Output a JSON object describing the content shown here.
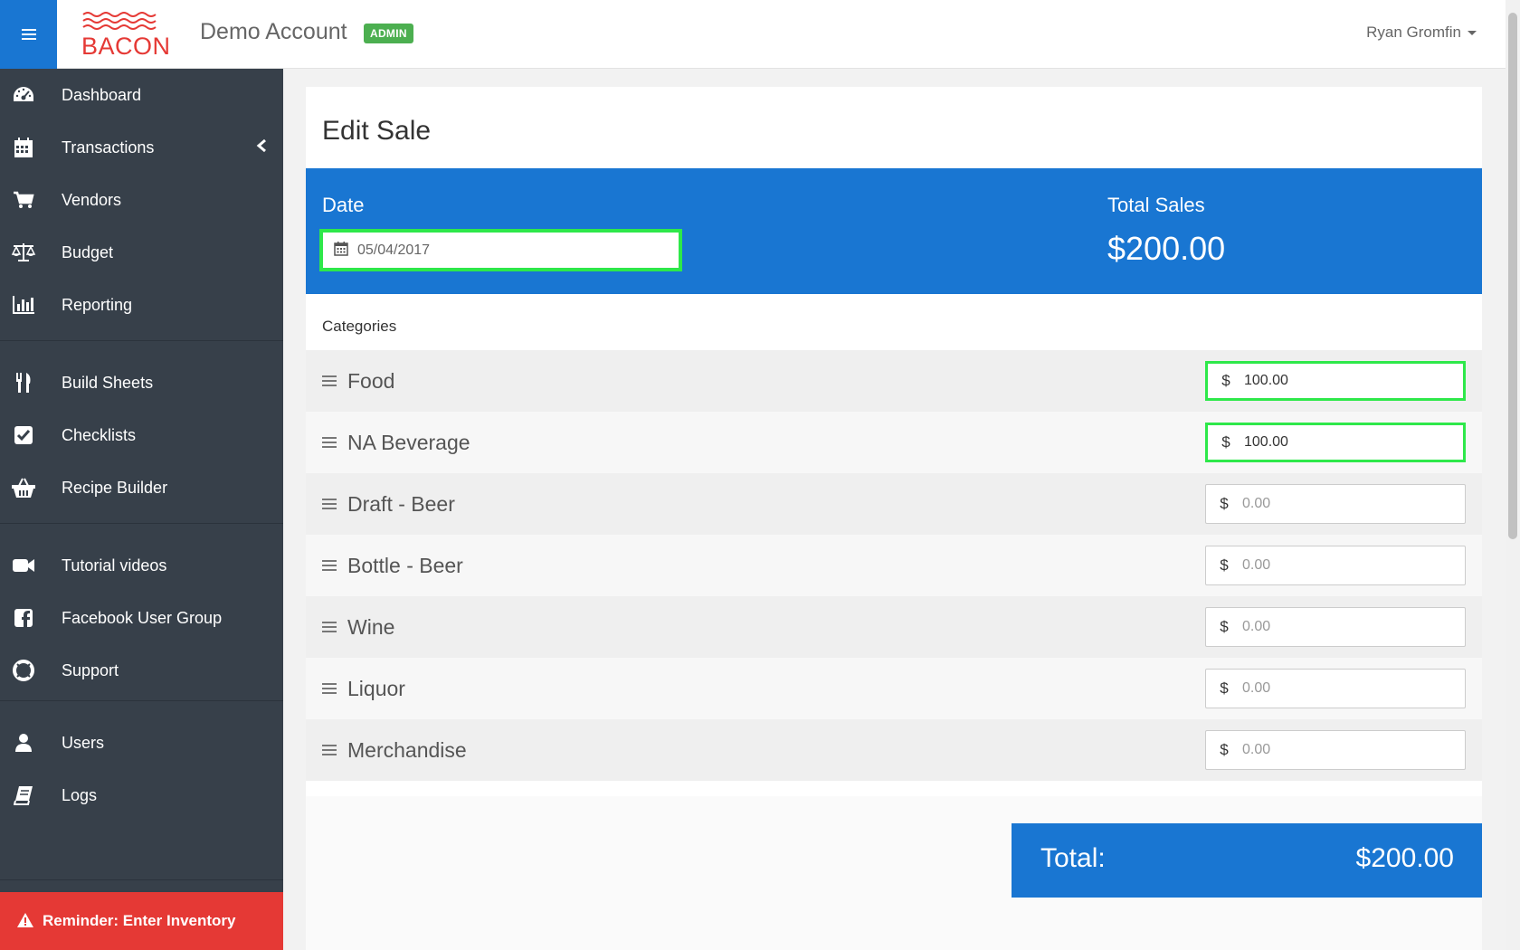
{
  "header": {
    "logo_text": "BACON",
    "account_name": "Demo Account",
    "badge": "ADMIN",
    "user_name": "Ryan Gromfin"
  },
  "sidebar": {
    "items": [
      {
        "label": "Dashboard",
        "icon": "dashboard-icon"
      },
      {
        "label": "Transactions",
        "icon": "calendar-icon"
      },
      {
        "label": "Vendors",
        "icon": "cart-icon"
      },
      {
        "label": "Budget",
        "icon": "balance-scale-icon"
      },
      {
        "label": "Reporting",
        "icon": "bar-chart-icon"
      },
      {
        "label": "Build Sheets",
        "icon": "utensils-icon"
      },
      {
        "label": "Checklists",
        "icon": "checkbox-icon"
      },
      {
        "label": "Recipe Builder",
        "icon": "basket-icon"
      },
      {
        "label": "Tutorial videos",
        "icon": "video-camera-icon"
      },
      {
        "label": "Facebook User Group",
        "icon": "facebook-icon"
      },
      {
        "label": "Support",
        "icon": "life-ring-icon"
      },
      {
        "label": "Users",
        "icon": "user-icon"
      },
      {
        "label": "Logs",
        "icon": "book-icon"
      }
    ],
    "reminder": "Reminder: Enter Inventory"
  },
  "page": {
    "title": "Edit Sale",
    "date_label": "Date",
    "date_value": "05/04/2017",
    "total_sales_label": "Total Sales",
    "total_sales_value": "$200.00",
    "categories_heading": "Categories",
    "currency_symbol": "$",
    "amount_placeholder": "0.00",
    "categories": [
      {
        "name": "Food",
        "value": "100.00"
      },
      {
        "name": "NA Beverage",
        "value": "100.00"
      },
      {
        "name": "Draft - Beer",
        "value": ""
      },
      {
        "name": "Bottle - Beer",
        "value": ""
      },
      {
        "name": "Wine",
        "value": ""
      },
      {
        "name": "Liquor",
        "value": ""
      },
      {
        "name": "Merchandise",
        "value": ""
      }
    ],
    "total_label": "Total:",
    "total_value": "$200.00"
  },
  "colors": {
    "primary": "#1976d2",
    "sidebar": "#37404a",
    "admin_badge": "#4caf50",
    "reminder": "#e53935",
    "logo": "#e53935",
    "focus_outline": "#2ee84a"
  }
}
